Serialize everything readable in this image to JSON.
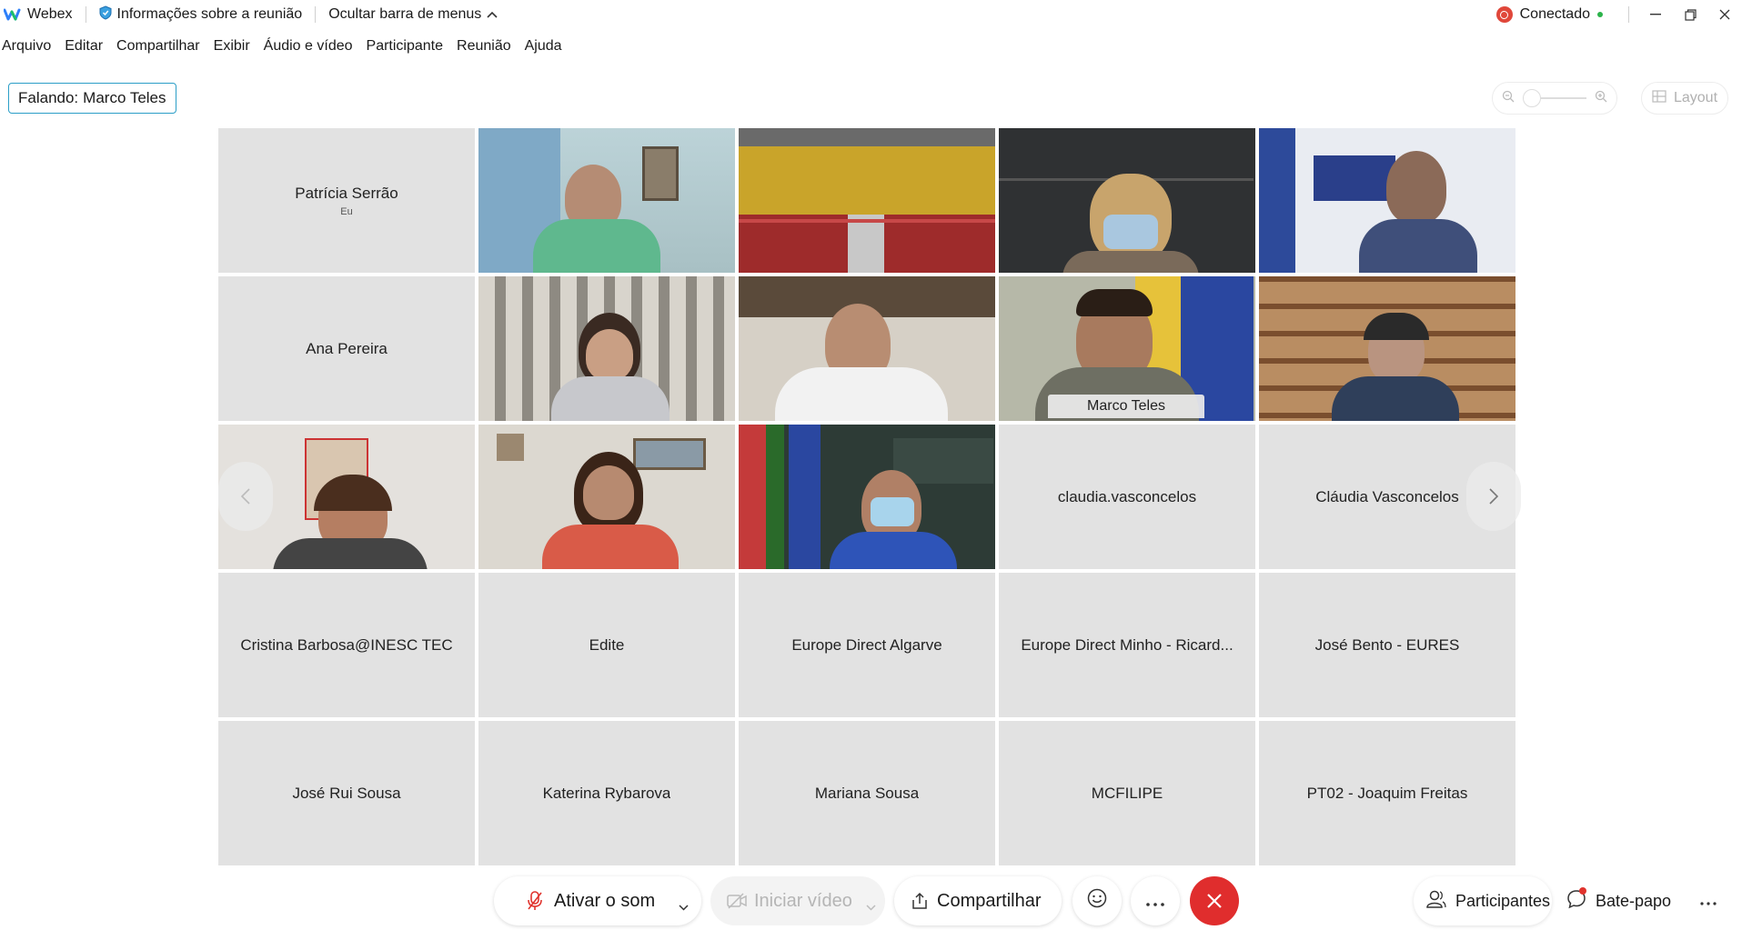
{
  "titlebar": {
    "app_name": "Webex",
    "meeting_info": "Informações sobre a reunião",
    "hide_menu": "Ocultar barra de menus",
    "status": "Conectado"
  },
  "menu": [
    "Arquivo",
    "Editar",
    "Compartilhar",
    "Exibir",
    "Áudio e vídeo",
    "Participante",
    "Reunião",
    "Ajuda"
  ],
  "speaking": {
    "label": "Falando:",
    "name": "Marco Teles"
  },
  "layout_label": "Layout",
  "tiles": [
    {
      "name": "Patrícia Serrão",
      "sub": "Eu"
    },
    {
      "name": ""
    },
    {
      "name": ""
    },
    {
      "name": ""
    },
    {
      "name": ""
    },
    {
      "name": "Ana Pereira"
    },
    {
      "name": ""
    },
    {
      "name": ""
    },
    {
      "name": "Marco Teles"
    },
    {
      "name": ""
    },
    {
      "name": ""
    },
    {
      "name": ""
    },
    {
      "name": ""
    },
    {
      "name": "claudia.vasconcelos"
    },
    {
      "name": "Cláudia Vasconcelos"
    },
    {
      "name": "Cristina Barbosa@INESC TEC"
    },
    {
      "name": "Edite"
    },
    {
      "name": "Europe Direct Algarve"
    },
    {
      "name": "Europe Direct Minho - Ricard..."
    },
    {
      "name": "José Bento - EURES"
    },
    {
      "name": "José Rui Sousa"
    },
    {
      "name": "Katerina Rybarova"
    },
    {
      "name": "Mariana Sousa"
    },
    {
      "name": "MCFILIPE"
    },
    {
      "name": "PT02 - Joaquim Freitas"
    }
  ],
  "toolbar": {
    "unmute": "Ativar o som",
    "start_video": "Iniciar vídeo",
    "share": "Compartilhar",
    "participants": "Participantes",
    "chat": "Bate-papo"
  },
  "colors": {
    "accent": "#17b3e0",
    "end_call": "#e02d2d",
    "tile_bg": "#e2e2e2"
  }
}
